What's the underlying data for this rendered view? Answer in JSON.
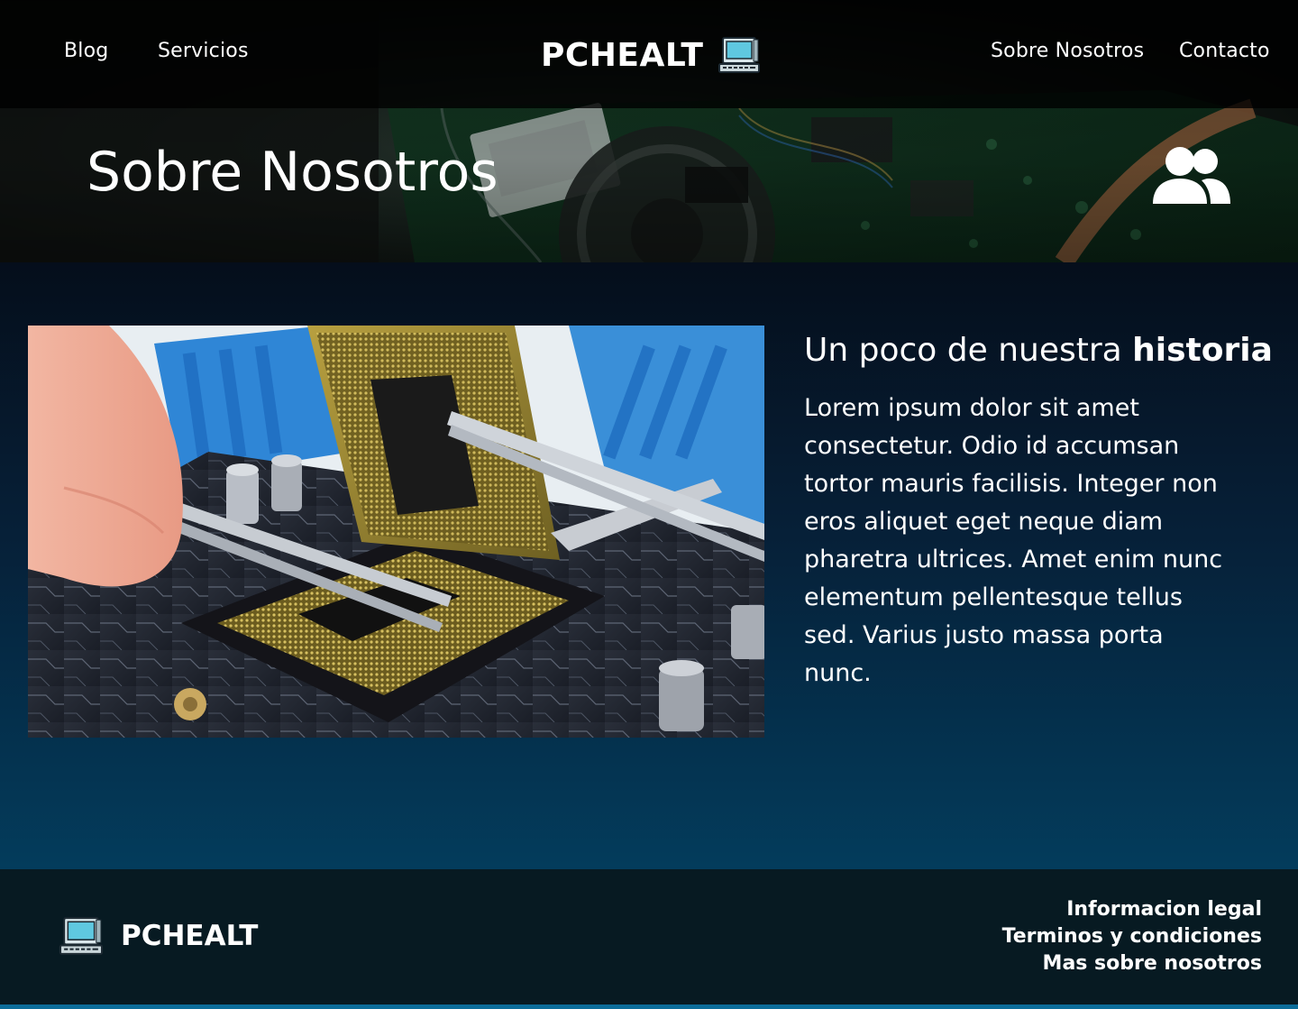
{
  "nav": {
    "left": [
      {
        "label": "Blog"
      },
      {
        "label": "Servicios"
      }
    ],
    "right": [
      {
        "label": "Sobre Nosotros"
      },
      {
        "label": "Contacto"
      }
    ],
    "brand": "PCHEALT"
  },
  "hero": {
    "title": "Sobre Nosotros",
    "icon": "users-icon"
  },
  "story": {
    "title_regular": "Un poco de nuestra ",
    "title_bold": "historia",
    "body": "Lorem ipsum dolor sit amet consectetur. Odio id accumsan tortor mauris facilisis. Integer non eros aliquet eget neque diam pharetra ultrices. Amet enim nunc elementum pellentesque tellus sed. Varius justo massa porta nunc."
  },
  "footer": {
    "brand": "PCHEALT",
    "links": [
      {
        "label": "Informacion legal"
      },
      {
        "label": "Terminos y condiciones"
      },
      {
        "label": "Mas sobre nosotros"
      }
    ]
  },
  "colors": {
    "main_top": "#050e1b",
    "main_bottom": "#033c5c",
    "footer_bg": "#071a22",
    "footer_accent": "#0c6d9a"
  }
}
